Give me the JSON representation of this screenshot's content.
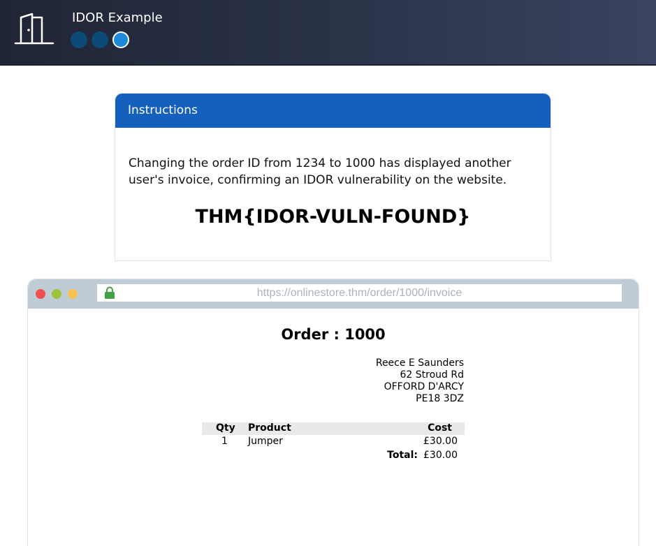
{
  "header": {
    "title": "IDOR Example",
    "icon": "door-icon",
    "progress": {
      "total": 3,
      "current": 3
    }
  },
  "instructions": {
    "heading": "Instructions",
    "text": "Changing the order ID from 1234 to 1000 has displayed another user's invoice, confirming an IDOR vulnerability on the website.",
    "flag": "THM{IDOR-VULN-FOUND}"
  },
  "browser": {
    "url": "https://onlinestore.thm/order/1000/invoice",
    "lock_icon": "lock-icon"
  },
  "invoice": {
    "title": "Order : 1000",
    "address": [
      "Reece E Saunders",
      "62 Stroud Rd",
      "OFFORD D'ARCY",
      "PE18 3DZ"
    ],
    "columns": {
      "qty": "Qty",
      "product": "Product",
      "cost": "Cost"
    },
    "items": [
      {
        "qty": "1",
        "product": "Jumper",
        "cost": "£30.00"
      }
    ],
    "total_label": "Total:",
    "total_value": "£30.00"
  },
  "colors": {
    "instructions_header": "#1560bd",
    "progress_active": "#1c8ad8",
    "progress_inactive": "#0d4a78",
    "browser_bar": "#bfcbd5"
  }
}
